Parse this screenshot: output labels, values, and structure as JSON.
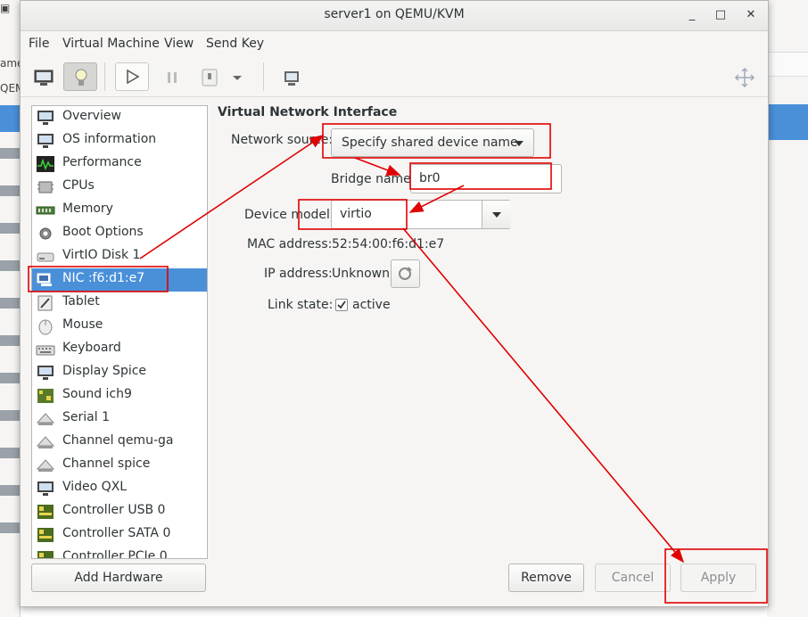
{
  "window": {
    "title": "server1 on QEMU/KVM"
  },
  "window_controls": {
    "minimize": "_",
    "maximize": "□",
    "close": "✕"
  },
  "background": {
    "left_text_1": "ame",
    "left_text_2": "QEM"
  },
  "menubar": [
    "File",
    "Virtual Machine",
    "View",
    "Send Key"
  ],
  "toolbar": {
    "icons": [
      "monitor-icon",
      "lightbulb-icon",
      "play-icon",
      "pause-icon",
      "power-icon",
      "chevron-down-icon",
      "snapshots-icon",
      "fullscreen-icon"
    ]
  },
  "sidebar": {
    "items": [
      {
        "label": "Overview",
        "icon": "monitor-icon"
      },
      {
        "label": "OS information",
        "icon": "monitor-icon"
      },
      {
        "label": "Performance",
        "icon": "performance-icon"
      },
      {
        "label": "CPUs",
        "icon": "cpu-icon"
      },
      {
        "label": "Memory",
        "icon": "memory-icon"
      },
      {
        "label": "Boot Options",
        "icon": "gear-icon"
      },
      {
        "label": "VirtIO Disk 1",
        "icon": "disk-icon"
      },
      {
        "label": "NIC :f6:d1:e7",
        "icon": "network-icon",
        "selected": true
      },
      {
        "label": "Tablet",
        "icon": "tablet-icon"
      },
      {
        "label": "Mouse",
        "icon": "mouse-icon"
      },
      {
        "label": "Keyboard",
        "icon": "keyboard-icon"
      },
      {
        "label": "Display Spice",
        "icon": "display-icon"
      },
      {
        "label": "Sound ich9",
        "icon": "sound-icon"
      },
      {
        "label": "Serial 1",
        "icon": "serial-icon"
      },
      {
        "label": "Channel qemu-ga",
        "icon": "channel-icon"
      },
      {
        "label": "Channel spice",
        "icon": "channel-icon"
      },
      {
        "label": "Video QXL",
        "icon": "monitor-icon"
      },
      {
        "label": "Controller USB 0",
        "icon": "controller-icon"
      },
      {
        "label": "Controller SATA 0",
        "icon": "controller-icon"
      },
      {
        "label": "Controller PCIe 0",
        "icon": "controller-icon"
      }
    ]
  },
  "details": {
    "section_title": "Virtual Network Interface",
    "network_source_label": "Network source:",
    "network_source_value": "Specify shared device name",
    "bridge_name_label": "Bridge name:",
    "bridge_name_value": "br0",
    "device_model_label": "Device model:",
    "device_model_value": "virtio",
    "mac_label": "MAC address:",
    "mac_value": "52:54:00:f6:d1:e7",
    "ip_label": "IP address:",
    "ip_value": "Unknown",
    "link_state_label": "Link state:",
    "link_state_value": "active",
    "link_state_checked": true
  },
  "buttons": {
    "add_hardware": "Add Hardware",
    "remove": "Remove",
    "cancel": "Cancel",
    "apply": "Apply"
  },
  "colors": {
    "selection": "#4a90d9",
    "annotation_red": "#e00000"
  }
}
